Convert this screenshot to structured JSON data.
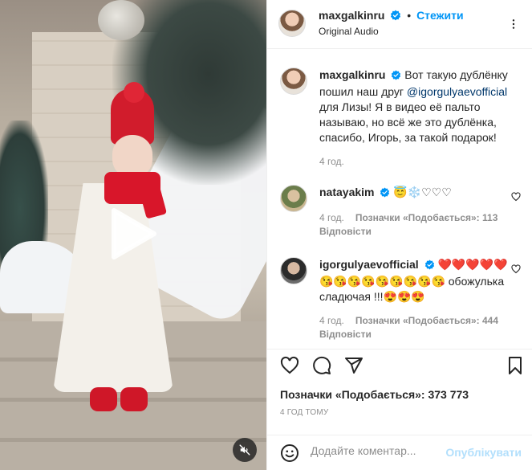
{
  "post": {
    "author": "maxgalkinru",
    "follow_label": "Стежити",
    "separator": "•",
    "audio": "Original Audio",
    "caption": "Вот такую дублёнку пошил наш друг ",
    "caption_mention": "@igorgulyaevofficial",
    "caption_rest": " для Лизы! Я в видео её пальто называю, но всё же это дублёнка, спасибо, Игорь, за такой подарок!",
    "caption_time": "4 год."
  },
  "comments": [
    {
      "user": "natayakim",
      "text": "😇❄️♡♡♡",
      "time": "4 год.",
      "likes": "Позначки «Подобається»: 113",
      "reply": "Відповісти"
    },
    {
      "user": "igorgulyaevofficial",
      "text": "❤️❤️❤️❤️❤️😘😘😘😘😘😘😘😘😘 обожулька сладючая !!!😍😍😍",
      "time": "4 год.",
      "likes": "Позначки «Подобається»: 444",
      "reply": "Відповісти"
    }
  ],
  "likes_total": "Позначки «Подобається»: 373 773",
  "time_ago": "4 ГОД ТОМУ",
  "add_comment": {
    "placeholder": "Додайте коментар...",
    "post_label": "Опублікувати"
  },
  "colors": {
    "accent": "#0095f6",
    "post_disabled": "#b2dffc",
    "secondary_text": "#8e8e8e",
    "mention": "#00376b"
  }
}
